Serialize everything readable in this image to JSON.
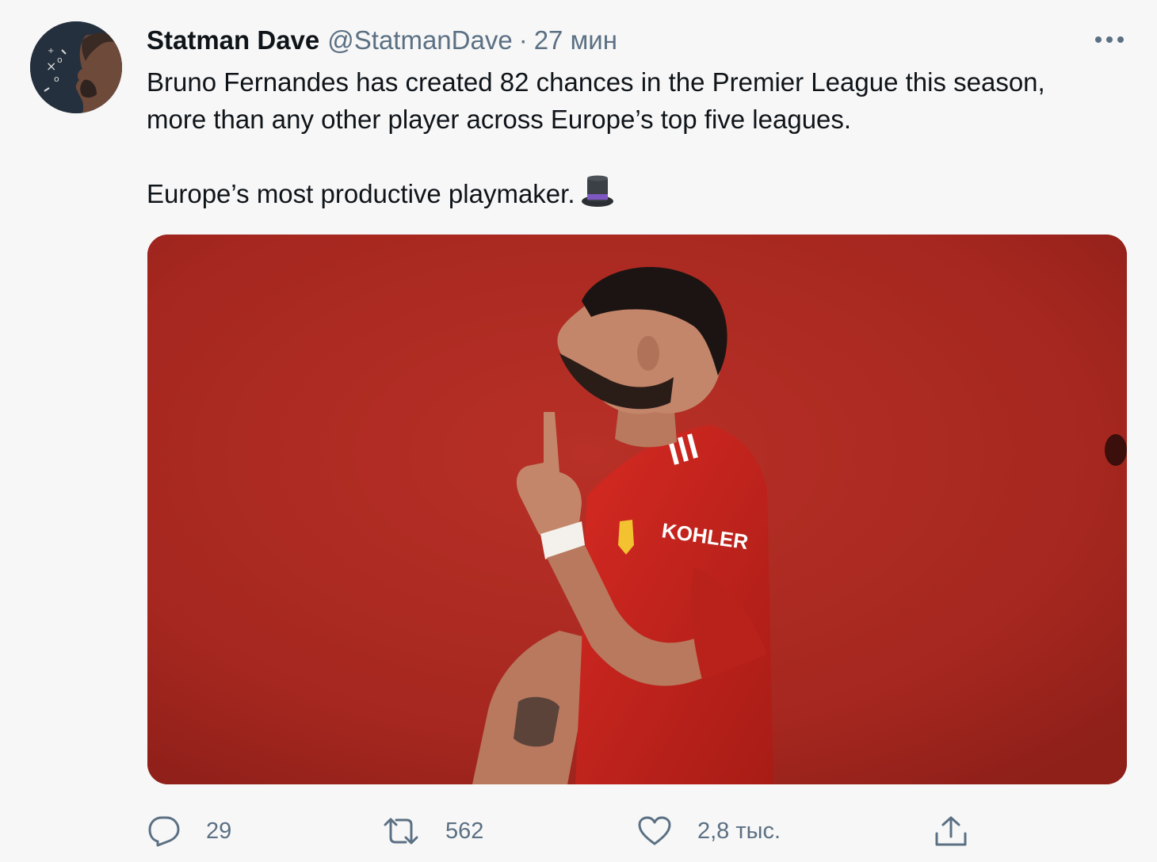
{
  "author": {
    "display_name": "Statman Dave",
    "handle": "@StatmanDave",
    "separator": "·",
    "time": "27 мин",
    "avatar_icon": "tactics-board-portrait-avatar"
  },
  "tweet": {
    "line1": "Bruno Fernandes has created 82 chances in the Premier League this season,",
    "line2": "more than any other player across Europe’s top five leagues.",
    "line3": "Europe’s most productive playmaker.",
    "emoji_icon": "top-hat-emoji"
  },
  "media": {
    "kit_sponsor": "KOHLER"
  },
  "actions": {
    "reply_count": "29",
    "retweet_count": "562",
    "like_count": "2,8 тыс."
  },
  "colors": {
    "text": "#0f1419",
    "secondary": "#5b7083",
    "background": "#f7f7f7",
    "photo_red": "#a5271f"
  }
}
